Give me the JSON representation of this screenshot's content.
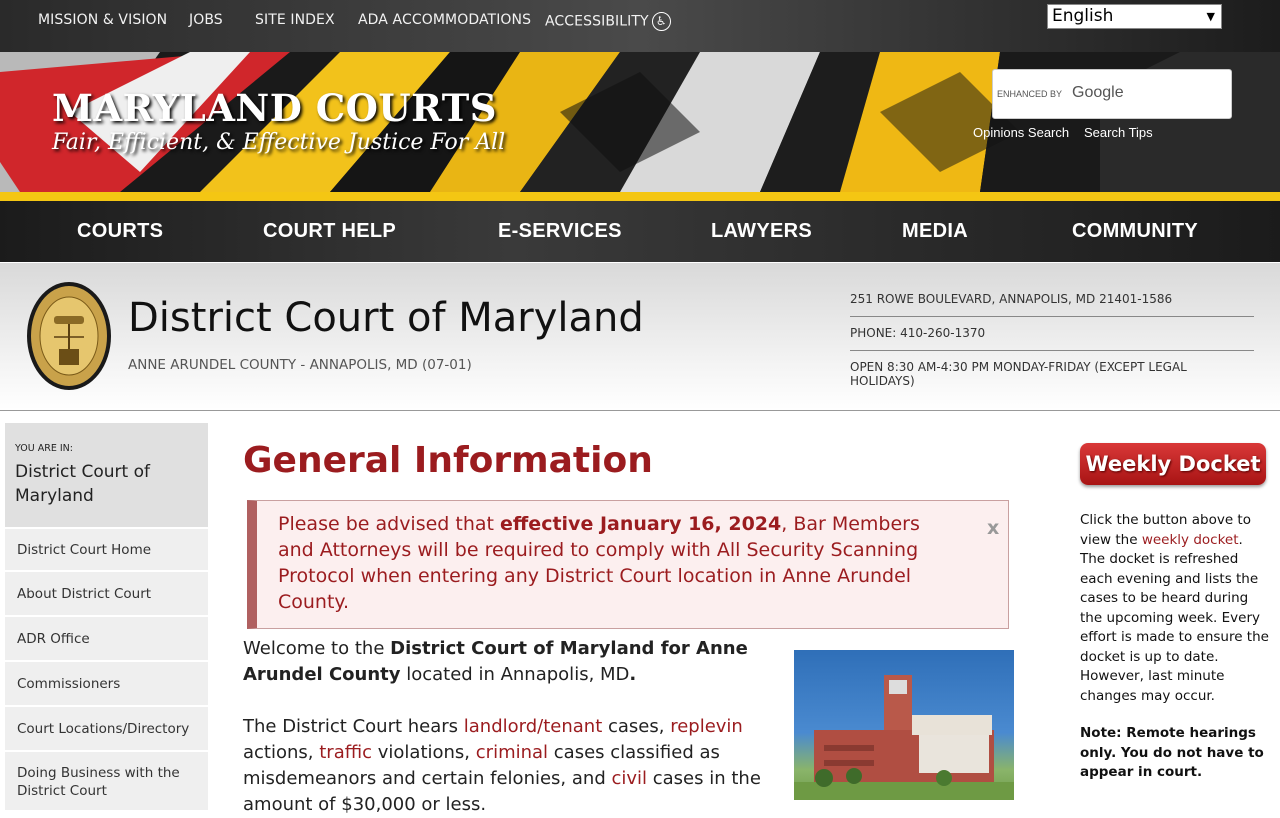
{
  "util_nav": [
    "MISSION & VISION",
    "JOBS",
    "SITE INDEX",
    "ADA ACCOMMODATIONS",
    "ACCESSIBILITY"
  ],
  "language": {
    "selected": "English"
  },
  "brand": {
    "title": "MARYLAND COURTS",
    "tagline": "Fair, Efficient, & Effective Justice For All"
  },
  "search": {
    "enhanced": "ENHANCED BY",
    "provider": "Google",
    "links": [
      "Opinions Search",
      "Search Tips"
    ]
  },
  "main_nav": [
    "COURTS",
    "COURT HELP",
    "E-SERVICES",
    "LAWYERS",
    "MEDIA",
    "COMMUNITY"
  ],
  "court": {
    "name": "District Court of Maryland",
    "location": "ANNE ARUNDEL COUNTY - ANNAPOLIS, MD (07-01)",
    "address": "251 ROWE BOULEVARD, ANNAPOLIS, MD 21401-1586",
    "phone": "PHONE: 410-260-1370",
    "hours": "OPEN 8:30 AM-4:30 PM MONDAY-FRIDAY (EXCEPT LEGAL HOLIDAYS)"
  },
  "sidebar": {
    "you_are_in_label": "YOU ARE IN:",
    "current": "District Court of Maryland",
    "items": [
      "District Court Home",
      "About District Court",
      "ADR Office",
      "Commissioners",
      "Court Locations/Directory",
      "Doing Business with the District Court"
    ]
  },
  "main": {
    "title": "General Information",
    "alert": {
      "pre": "Please be advised that ",
      "bold": "effective January 16, 2024",
      "post": ", Bar Members and Attorneys will be required to comply with All Security Scanning Protocol when entering any District Court location in Anne Arundel County.",
      "close": "x"
    },
    "welcome": {
      "pre": "Welcome to the ",
      "bold": "District Court of Maryland for Anne Arundel County",
      "post": " located in Annapolis, MD",
      "end": "."
    },
    "para2": {
      "t1": "The District Court hears ",
      "l1": "landlord/tenant",
      "t2": " cases, ",
      "l2": "replevin",
      "t3": " actions, ",
      "l3": "traffic",
      "t4": " violations, ",
      "l4": "criminal",
      "t5": " cases classified as misdemeanors and certain felonies, and ",
      "l5": "civil",
      "t6": " cases in the amount of $30,000 or less."
    }
  },
  "right": {
    "docket_button": "Weekly Docket",
    "desc_pre": "Click the button above to view the ",
    "desc_link": "weekly docket",
    "desc_post": ". The docket is refreshed each evening and lists the cases to be heard during the upcoming week. Every effort is made to ensure the docket is up to date. However, last minute changes may occur.",
    "note": "Note: Remote hearings only. You do not have to appear in court."
  }
}
